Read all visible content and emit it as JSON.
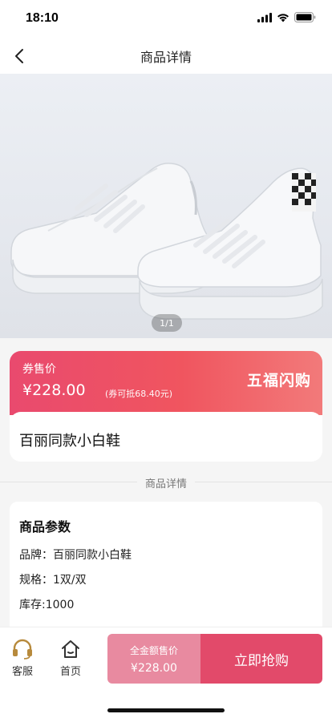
{
  "status_bar": {
    "time": "18:10"
  },
  "nav": {
    "title": "商品详情"
  },
  "gallery": {
    "indicator": "1/1"
  },
  "price_card": {
    "coupon_label": "券售价",
    "price": "¥228.00",
    "coupon_deduct": "(券可抵68.40元)",
    "promo_brand": "五福闪购",
    "product_title": "百丽同款小白鞋"
  },
  "details_divider": "商品详情",
  "params": {
    "heading": "商品参数",
    "rows": [
      "品牌：百丽同款小白鞋",
      "规格：1双/双",
      "库存:1000"
    ]
  },
  "bottom_bar": {
    "service_label": "客服",
    "home_label": "首页",
    "full_price_label": "全金额售价",
    "full_price_value": "¥228.00",
    "buy_label": "立即抢购"
  },
  "colors": {
    "accent": "#e24a6a",
    "accent_light": "#e88aa0",
    "banner_start": "#e94a6e",
    "icon_gold": "#b78a3c"
  },
  "icons": {
    "back": "chevron-left-icon",
    "service": "headset-icon",
    "home": "home-icon"
  }
}
